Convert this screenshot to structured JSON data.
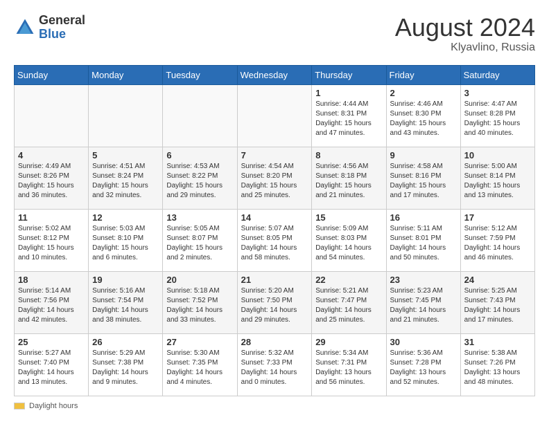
{
  "header": {
    "logo_general": "General",
    "logo_blue": "Blue",
    "month_year": "August 2024",
    "location": "Klyavlino, Russia"
  },
  "calendar": {
    "weekdays": [
      "Sunday",
      "Monday",
      "Tuesday",
      "Wednesday",
      "Thursday",
      "Friday",
      "Saturday"
    ],
    "weeks": [
      [
        {
          "day": "",
          "info": ""
        },
        {
          "day": "",
          "info": ""
        },
        {
          "day": "",
          "info": ""
        },
        {
          "day": "",
          "info": ""
        },
        {
          "day": "1",
          "info": "Sunrise: 4:44 AM\nSunset: 8:31 PM\nDaylight: 15 hours\nand 47 minutes."
        },
        {
          "day": "2",
          "info": "Sunrise: 4:46 AM\nSunset: 8:30 PM\nDaylight: 15 hours\nand 43 minutes."
        },
        {
          "day": "3",
          "info": "Sunrise: 4:47 AM\nSunset: 8:28 PM\nDaylight: 15 hours\nand 40 minutes."
        }
      ],
      [
        {
          "day": "4",
          "info": "Sunrise: 4:49 AM\nSunset: 8:26 PM\nDaylight: 15 hours\nand 36 minutes."
        },
        {
          "day": "5",
          "info": "Sunrise: 4:51 AM\nSunset: 8:24 PM\nDaylight: 15 hours\nand 32 minutes."
        },
        {
          "day": "6",
          "info": "Sunrise: 4:53 AM\nSunset: 8:22 PM\nDaylight: 15 hours\nand 29 minutes."
        },
        {
          "day": "7",
          "info": "Sunrise: 4:54 AM\nSunset: 8:20 PM\nDaylight: 15 hours\nand 25 minutes."
        },
        {
          "day": "8",
          "info": "Sunrise: 4:56 AM\nSunset: 8:18 PM\nDaylight: 15 hours\nand 21 minutes."
        },
        {
          "day": "9",
          "info": "Sunrise: 4:58 AM\nSunset: 8:16 PM\nDaylight: 15 hours\nand 17 minutes."
        },
        {
          "day": "10",
          "info": "Sunrise: 5:00 AM\nSunset: 8:14 PM\nDaylight: 15 hours\nand 13 minutes."
        }
      ],
      [
        {
          "day": "11",
          "info": "Sunrise: 5:02 AM\nSunset: 8:12 PM\nDaylight: 15 hours\nand 10 minutes."
        },
        {
          "day": "12",
          "info": "Sunrise: 5:03 AM\nSunset: 8:10 PM\nDaylight: 15 hours\nand 6 minutes."
        },
        {
          "day": "13",
          "info": "Sunrise: 5:05 AM\nSunset: 8:07 PM\nDaylight: 15 hours\nand 2 minutes."
        },
        {
          "day": "14",
          "info": "Sunrise: 5:07 AM\nSunset: 8:05 PM\nDaylight: 14 hours\nand 58 minutes."
        },
        {
          "day": "15",
          "info": "Sunrise: 5:09 AM\nSunset: 8:03 PM\nDaylight: 14 hours\nand 54 minutes."
        },
        {
          "day": "16",
          "info": "Sunrise: 5:11 AM\nSunset: 8:01 PM\nDaylight: 14 hours\nand 50 minutes."
        },
        {
          "day": "17",
          "info": "Sunrise: 5:12 AM\nSunset: 7:59 PM\nDaylight: 14 hours\nand 46 minutes."
        }
      ],
      [
        {
          "day": "18",
          "info": "Sunrise: 5:14 AM\nSunset: 7:56 PM\nDaylight: 14 hours\nand 42 minutes."
        },
        {
          "day": "19",
          "info": "Sunrise: 5:16 AM\nSunset: 7:54 PM\nDaylight: 14 hours\nand 38 minutes."
        },
        {
          "day": "20",
          "info": "Sunrise: 5:18 AM\nSunset: 7:52 PM\nDaylight: 14 hours\nand 33 minutes."
        },
        {
          "day": "21",
          "info": "Sunrise: 5:20 AM\nSunset: 7:50 PM\nDaylight: 14 hours\nand 29 minutes."
        },
        {
          "day": "22",
          "info": "Sunrise: 5:21 AM\nSunset: 7:47 PM\nDaylight: 14 hours\nand 25 minutes."
        },
        {
          "day": "23",
          "info": "Sunrise: 5:23 AM\nSunset: 7:45 PM\nDaylight: 14 hours\nand 21 minutes."
        },
        {
          "day": "24",
          "info": "Sunrise: 5:25 AM\nSunset: 7:43 PM\nDaylight: 14 hours\nand 17 minutes."
        }
      ],
      [
        {
          "day": "25",
          "info": "Sunrise: 5:27 AM\nSunset: 7:40 PM\nDaylight: 14 hours\nand 13 minutes."
        },
        {
          "day": "26",
          "info": "Sunrise: 5:29 AM\nSunset: 7:38 PM\nDaylight: 14 hours\nand 9 minutes."
        },
        {
          "day": "27",
          "info": "Sunrise: 5:30 AM\nSunset: 7:35 PM\nDaylight: 14 hours\nand 4 minutes."
        },
        {
          "day": "28",
          "info": "Sunrise: 5:32 AM\nSunset: 7:33 PM\nDaylight: 14 hours\nand 0 minutes."
        },
        {
          "day": "29",
          "info": "Sunrise: 5:34 AM\nSunset: 7:31 PM\nDaylight: 13 hours\nand 56 minutes."
        },
        {
          "day": "30",
          "info": "Sunrise: 5:36 AM\nSunset: 7:28 PM\nDaylight: 13 hours\nand 52 minutes."
        },
        {
          "day": "31",
          "info": "Sunrise: 5:38 AM\nSunset: 7:26 PM\nDaylight: 13 hours\nand 48 minutes."
        }
      ]
    ]
  },
  "footer": {
    "daylight_label": "Daylight hours"
  }
}
